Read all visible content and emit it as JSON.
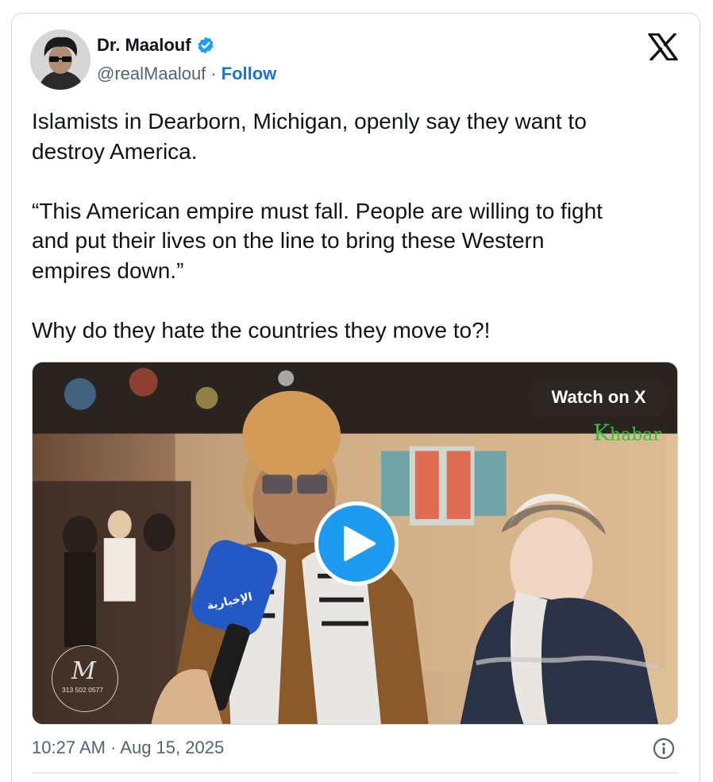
{
  "author": {
    "display_name": "Dr. Maalouf",
    "handle": "@realMaalouf",
    "separator": "·",
    "follow_label": "Follow",
    "verified_icon": "verified-badge-icon",
    "verified_color": "#1d9bf0"
  },
  "brand_icon": "x-logo-icon",
  "tweet_text": "Islamists in Dearborn, Michigan, openly say they want to\ndestroy America.\n\n“This American empire must fall. People are willing to fight\nand put their lives on the line to bring these Western\nempires down.”\n\nWhy do they hate the countries they move to?!",
  "media": {
    "watch_label": "Watch on X",
    "channel_logo_big": "K",
    "channel_logo_rest": "habar",
    "mic_text": "الإخبارية",
    "watermark_glyph": "M",
    "watermark_number": "313 502 0577",
    "play_icon": "play-icon"
  },
  "timestamp": "10:27 AM · Aug 15, 2025",
  "info_icon": "info-icon",
  "colors": {
    "accent": "#1d9bf0",
    "link": "#1d74c9",
    "secondary_text": "#536471",
    "border": "#cfd9de"
  }
}
